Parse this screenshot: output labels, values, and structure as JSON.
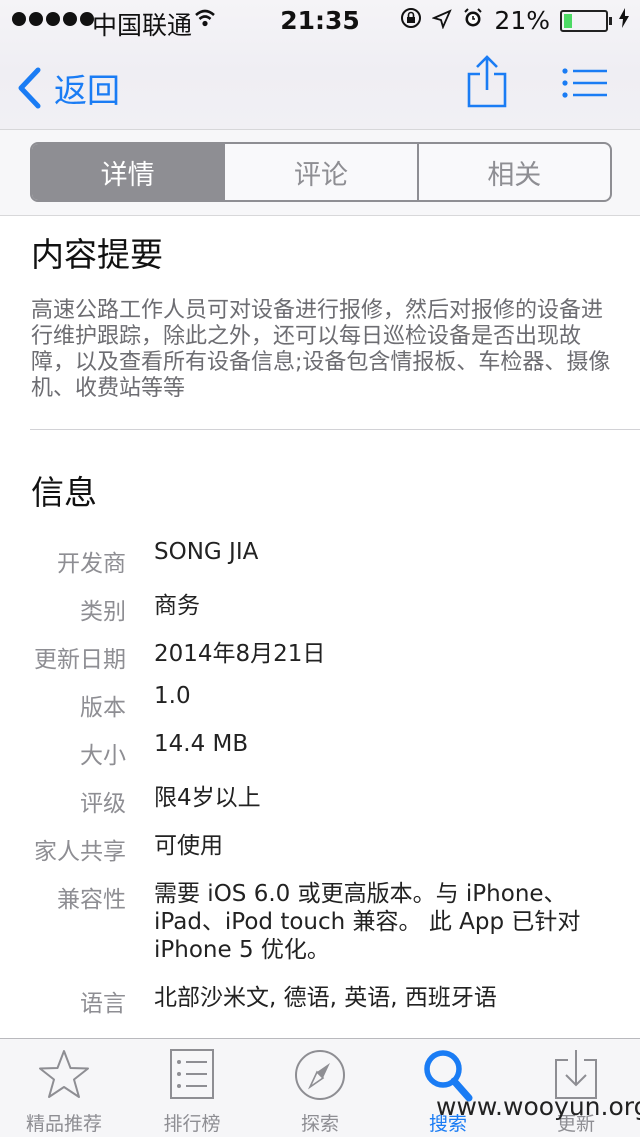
{
  "status_bar": {
    "carrier": "中国联通",
    "time": "21:35",
    "battery": "21%",
    "battery_level": 0.21
  },
  "nav": {
    "back_label": "返回"
  },
  "segments": [
    {
      "label": "详情",
      "active": true
    },
    {
      "label": "评论",
      "active": false
    },
    {
      "label": "相关",
      "active": false
    }
  ],
  "summary": {
    "title": "内容提要",
    "text": "高速公路工作人员可对设备进行报修，然后对报修的设备进行维护跟踪，除此之外，还可以每日巡检设备是否出现故障，以及查看所有设备信息;设备包含情报板、车检器、摄像机、收费站等等"
  },
  "info": {
    "title": "信息",
    "rows": [
      {
        "label": "开发商",
        "value": "SONG JIA"
      },
      {
        "label": "类别",
        "value": "商务"
      },
      {
        "label": "更新日期",
        "value": "2014年8月21日"
      },
      {
        "label": "版本",
        "value": "1.0"
      },
      {
        "label": "大小",
        "value": "14.4 MB"
      },
      {
        "label": "评级",
        "value": "限4岁以上"
      },
      {
        "label": "家人共享",
        "value": "可使用"
      },
      {
        "label": "兼容性",
        "value": "需要 iOS 6.0 或更高版本。与 iPhone、iPad、iPod touch 兼容。 此 App 已针对 iPhone 5 优化。"
      },
      {
        "label": "语言",
        "value": "北部沙米文, 德语, 英语, 西班牙语"
      }
    ]
  },
  "tabbar": {
    "items": [
      {
        "label": "精品推荐",
        "icon": "star-icon"
      },
      {
        "label": "排行榜",
        "icon": "ranking-list-icon"
      },
      {
        "label": "探索",
        "icon": "compass-icon"
      },
      {
        "label": "搜索",
        "icon": "search-icon"
      },
      {
        "label": "更新",
        "icon": "download-icon"
      }
    ],
    "active": "搜索"
  },
  "watermark": "www.wooyun.org",
  "colors": {
    "accent": "#1a7cf4",
    "segment_active": "#8e8e93",
    "battery_fill": "#4cd964"
  }
}
